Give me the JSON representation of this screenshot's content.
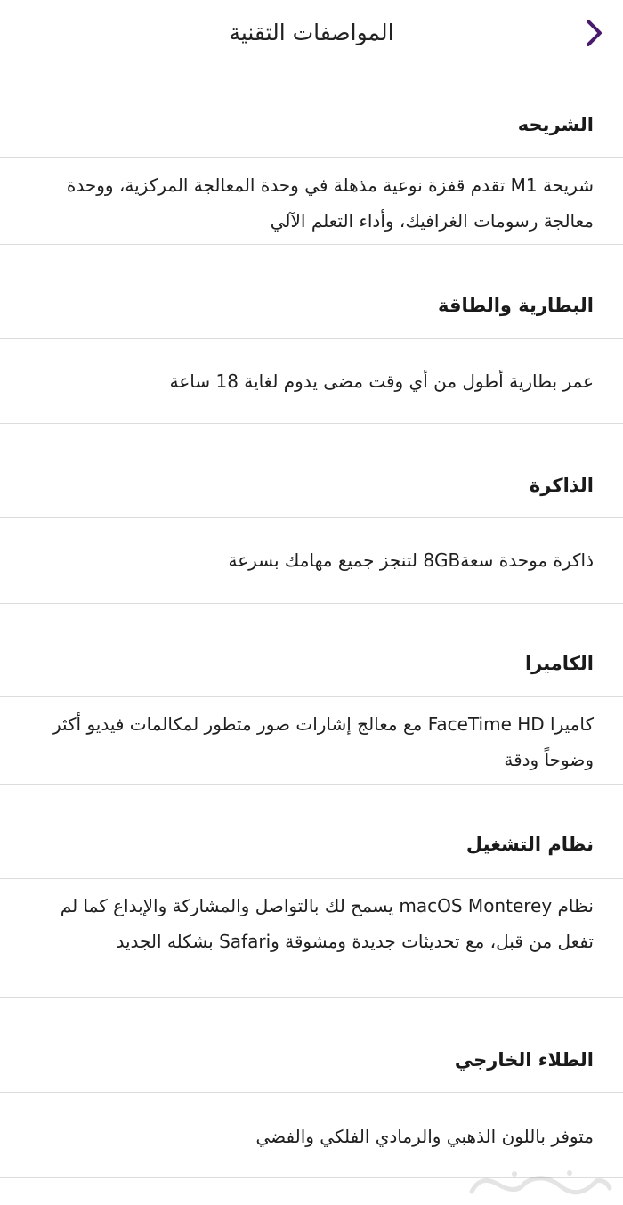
{
  "header": {
    "title": "المواصفات التقنية",
    "back_icon": "chevron-right-icon",
    "accent_color": "#4a1a6e"
  },
  "sections": [
    {
      "heading": "الشريحه",
      "body": "شريحة M1 تقدم قفزة نوعية مذهلة في وحدة المعالجة المركزية، ووحدة معالجة رسومات الغرافيك، وأداء التعلم الآلي"
    },
    {
      "heading": "البطارية والطاقة",
      "body": "عمر بطارية أطول من أي وقت مضى يدوم لغاية 18 ساعة"
    },
    {
      "heading": "الذاكرة",
      "body": "ذاكرة موحدة سعة8GB لتنجز جميع مهامك بسرعة"
    },
    {
      "heading": "الكاميرا",
      "body": "كاميرا FaceTime HD مع معالج إشارات صور متطور لمكالمات فيديو أكثر وضوحاً ودقة"
    },
    {
      "heading": "نظام التشغيل",
      "body": "نظام macOS Monterey يسمح لك بالتواصل والمشاركة والإبداع كما لم تفعل من قبل، مع تحديثات جديدة ومشوقة وSafari بشكله الجديد"
    },
    {
      "heading": "الطلاء الخارجي",
      "body": "متوفر باللون الذهبي والرمادي الفلكي والفضي"
    }
  ],
  "watermark": {
    "icon": "haraj-logo-watermark",
    "text": "حراج"
  }
}
